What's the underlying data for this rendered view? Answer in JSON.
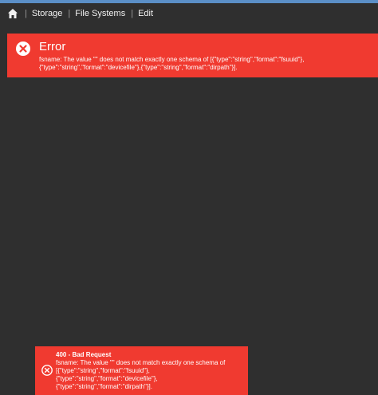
{
  "breadcrumb": {
    "items": [
      "Storage",
      "File Systems",
      "Edit"
    ]
  },
  "error_panel": {
    "title": "Error",
    "message": "fsname: The value \"\" does not match exactly one schema of [{\"type\":\"string\",\"format\":\"fsuuid\"},{\"type\":\"string\",\"format\":\"devicefile\"},{\"type\":\"string\",\"format\":\"dirpath\"}]."
  },
  "toast": {
    "title": "400 - Bad Request",
    "message": "fsname: The value \"\" does not match exactly one schema of [{\"type\":\"string\",\"format\":\"fsuuid\"},{\"type\":\"string\",\"format\":\"devicefile\"},{\"type\":\"string\",\"format\":\"dirpath\"}]."
  },
  "colors": {
    "background": "#2f2f2f",
    "error": "#f03a30",
    "accent": "#5b8fc7"
  },
  "icons": {
    "home": "home-icon",
    "error": "error-circle-x-icon"
  }
}
